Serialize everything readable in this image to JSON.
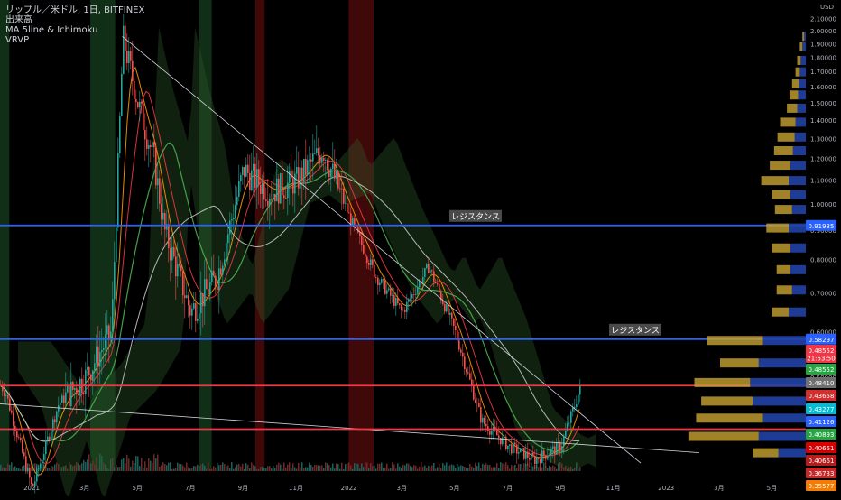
{
  "legend": {
    "line1": "リップル／米ドル, 1日, BITFINEX",
    "line2": "出来高",
    "line3": "MA 5line & Ichimoku",
    "line4": "VRVP"
  },
  "colors": {
    "background": "#000000",
    "resistance_line": "#2962ff",
    "support_line": "#f23645",
    "trendline": "#d1d4dc",
    "vp_up": "#c8a232",
    "vp_down": "#2142a6",
    "shade_green": "#14361a",
    "shade_red": "#4a0a0a"
  },
  "chart_data": {
    "type": "candlestick",
    "title": "リップル／米ドル, 1日, BITFINEX",
    "currency": "USD",
    "y_scale": "log",
    "ylim": [
      0.34,
      2.14
    ],
    "y_ticks": [
      {
        "value": 2.1,
        "label": "2.10000"
      },
      {
        "value": 2.0,
        "label": "2.00000"
      },
      {
        "value": 1.9,
        "label": "1.90000"
      },
      {
        "value": 1.8,
        "label": "1.80000"
      },
      {
        "value": 1.7,
        "label": "1.70000"
      },
      {
        "value": 1.6,
        "label": "1.60000"
      },
      {
        "value": 1.5,
        "label": "1.50000"
      },
      {
        "value": 1.4,
        "label": "1.40000"
      },
      {
        "value": 1.3,
        "label": "1.30000"
      },
      {
        "value": 1.2,
        "label": "1.20000"
      },
      {
        "value": 1.1,
        "label": "1.10000"
      },
      {
        "value": 1.0,
        "label": "1.00000"
      },
      {
        "value": 0.9,
        "label": "0.90000"
      },
      {
        "value": 0.8,
        "label": "0.80000"
      },
      {
        "value": 0.7,
        "label": "0.70000"
      },
      {
        "value": 0.6,
        "label": "0.60000"
      },
      {
        "value": 0.5,
        "label": "0.50000"
      },
      {
        "value": 0.4,
        "label": "0.40000"
      }
    ],
    "x_ticks": [
      "2021",
      "3月",
      "5月",
      "7月",
      "9月",
      "11月",
      "2022",
      "3月",
      "5月",
      "7月",
      "9月",
      "11月",
      "2023",
      "3月",
      "5月"
    ],
    "price_labels": [
      {
        "value": 0.91935,
        "label": "0.91935",
        "color": "#2962ff"
      },
      {
        "value": 0.58297,
        "label": "0.58297",
        "color": "#2962ff"
      },
      {
        "value": 0.48552,
        "label": "0.48552",
        "sub": "21:53:50",
        "color": "#f23645"
      },
      {
        "value": 0.48552,
        "label": "0.48552",
        "color": "#26a641"
      },
      {
        "value": 0.4841,
        "label": "0.48410",
        "color": "#707070"
      },
      {
        "value": 0.43658,
        "label": "0.43658",
        "color": "#d32f2f"
      },
      {
        "value": 0.43277,
        "label": "0.43277",
        "color": "#00bcd4"
      },
      {
        "value": 0.41126,
        "label": "0.41126",
        "color": "#2962ff"
      },
      {
        "value": 0.40893,
        "label": "0.40893",
        "color": "#26a641"
      },
      {
        "value": 0.40661,
        "label": "0.40661",
        "color": "#d50000"
      },
      {
        "value": 0.40661,
        "label": "0.40661",
        "color": "#b71c1c"
      },
      {
        "value": 0.36733,
        "label": "0.36733",
        "color": "#c62828"
      },
      {
        "value": 0.35577,
        "label": "0.35577",
        "color": "#f57c00"
      }
    ],
    "horizontal_lines": [
      {
        "value": 0.91935,
        "color": "#2962ff",
        "label": "レジスタンス"
      },
      {
        "value": 0.58297,
        "color": "#2962ff",
        "label": "レジスタンス"
      },
      {
        "value": 0.4841,
        "color": "#f23645"
      },
      {
        "value": 0.40661,
        "color": "#f23645"
      }
    ],
    "volume_profile": [
      {
        "price": 1.96,
        "up": 0.02,
        "down": 0.02
      },
      {
        "price": 1.88,
        "up": 0.03,
        "down": 0.04
      },
      {
        "price": 1.78,
        "up": 0.04,
        "down": 0.06
      },
      {
        "price": 1.7,
        "up": 0.05,
        "down": 0.07
      },
      {
        "price": 1.62,
        "up": 0.08,
        "down": 0.08
      },
      {
        "price": 1.55,
        "up": 0.1,
        "down": 0.09
      },
      {
        "price": 1.47,
        "up": 0.12,
        "down": 0.1
      },
      {
        "price": 1.39,
        "up": 0.18,
        "down": 0.12
      },
      {
        "price": 1.31,
        "up": 0.2,
        "down": 0.13
      },
      {
        "price": 1.24,
        "up": 0.22,
        "down": 0.15
      },
      {
        "price": 1.17,
        "up": 0.24,
        "down": 0.18
      },
      {
        "price": 1.1,
        "up": 0.32,
        "down": 0.2
      },
      {
        "price": 1.04,
        "up": 0.22,
        "down": 0.18
      },
      {
        "price": 0.98,
        "up": 0.2,
        "down": 0.16
      },
      {
        "price": 0.91,
        "up": 0.26,
        "down": 0.2
      },
      {
        "price": 0.84,
        "up": 0.22,
        "down": 0.18
      },
      {
        "price": 0.77,
        "up": 0.16,
        "down": 0.18
      },
      {
        "price": 0.71,
        "up": 0.18,
        "down": 0.16
      },
      {
        "price": 0.65,
        "up": 0.2,
        "down": 0.2
      },
      {
        "price": 0.58,
        "up": 0.65,
        "down": 0.5
      },
      {
        "price": 0.53,
        "up": 0.45,
        "down": 0.55
      },
      {
        "price": 0.49,
        "up": 0.65,
        "down": 0.65
      },
      {
        "price": 0.455,
        "up": 0.6,
        "down": 0.62
      },
      {
        "price": 0.425,
        "up": 0.78,
        "down": 0.5
      },
      {
        "price": 0.395,
        "up": 0.82,
        "down": 0.55
      },
      {
        "price": 0.37,
        "up": 0.3,
        "down": 0.32
      }
    ],
    "series": [
      {
        "name": "XRP/USD",
        "dates": [
          "2020-11",
          "2020-12",
          "2021-01",
          "2021-02",
          "2021-03",
          "2021-04",
          "2021-04-14",
          "2021-05",
          "2021-05-19",
          "2021-06",
          "2021-07",
          "2021-08",
          "2021-09",
          "2021-10",
          "2021-11",
          "2021-12",
          "2022-01",
          "2022-02",
          "2022-03",
          "2022-04",
          "2022-05",
          "2022-06",
          "2022-07",
          "2022-08",
          "2022-09",
          "2022-09-23"
        ],
        "values": [
          0.55,
          0.47,
          0.32,
          0.45,
          0.5,
          0.6,
          1.95,
          1.5,
          1.2,
          0.9,
          0.65,
          0.75,
          1.15,
          1.05,
          1.1,
          1.25,
          0.95,
          0.75,
          0.65,
          0.78,
          0.6,
          0.42,
          0.38,
          0.36,
          0.38,
          0.48
        ]
      }
    ],
    "shaded_periods": [
      {
        "color": "green",
        "from": 0.0,
        "to": 0.015
      },
      {
        "color": "green",
        "from": 0.145,
        "to": 0.185
      },
      {
        "color": "green",
        "from": 0.32,
        "to": 0.34
      },
      {
        "color": "red",
        "from": 0.41,
        "to": 0.425
      },
      {
        "color": "red",
        "from": 0.56,
        "to": 0.6
      }
    ]
  }
}
